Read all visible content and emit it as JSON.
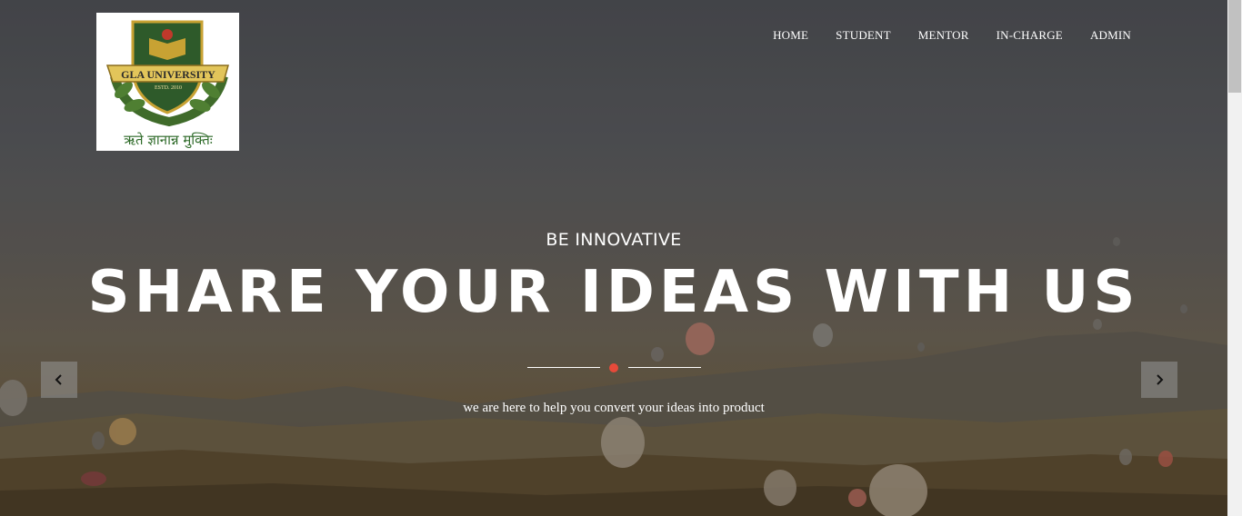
{
  "logo": {
    "name_text": "GLA UNIVERSITY",
    "estd_text": "ESTD. 2010",
    "motto_text": "ऋते ज्ञानान्न मुक्तिः"
  },
  "nav": {
    "items": [
      {
        "label": "HOME"
      },
      {
        "label": "STUDENT"
      },
      {
        "label": "MENTOR"
      },
      {
        "label": "IN-CHARGE"
      },
      {
        "label": "ADMIN"
      }
    ]
  },
  "hero": {
    "kicker": "BE INNOVATIVE",
    "headline": "SHARE YOUR IDEAS WITH US",
    "tagline": "we are here to help you convert your ideas into product"
  },
  "carousel": {
    "prev_icon": "chevron-left-icon",
    "next_icon": "chevron-right-icon"
  },
  "colors": {
    "accent_dot": "#e64a3a",
    "text": "#ffffff"
  }
}
